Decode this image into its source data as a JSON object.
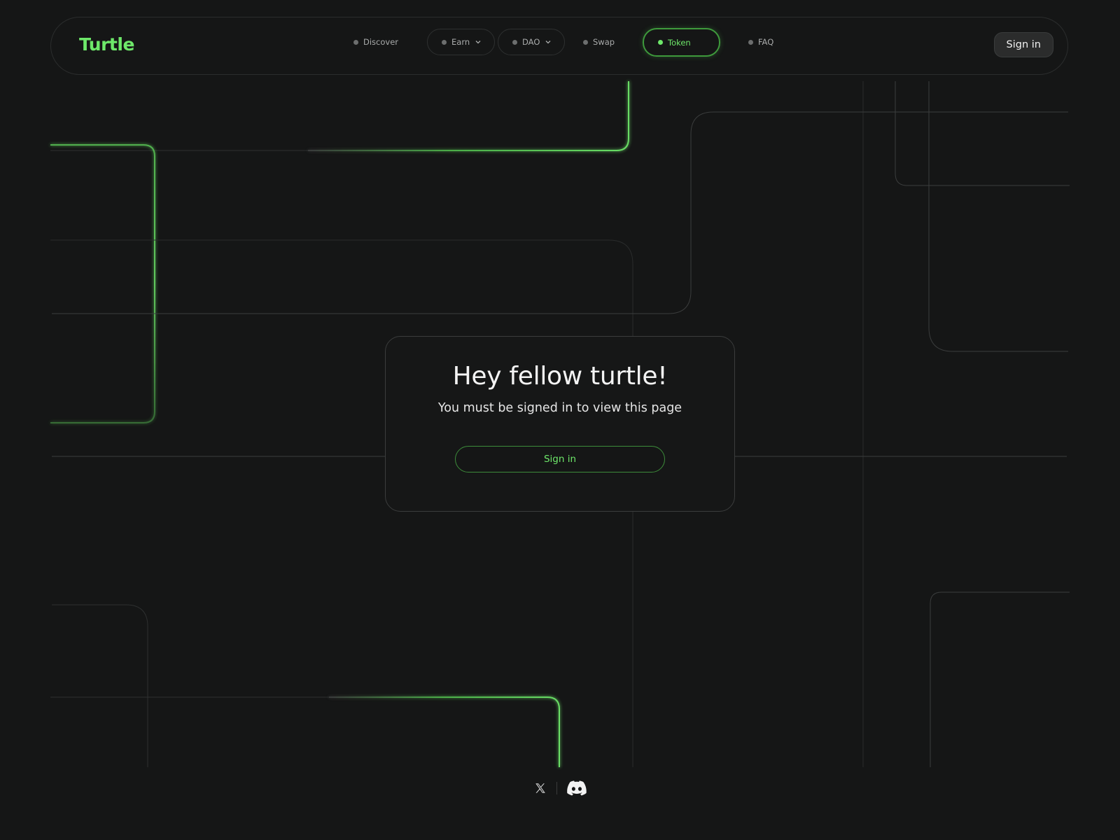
{
  "brand": {
    "name": "Turtle",
    "accent_color": "#6ee86a"
  },
  "nav": {
    "items": [
      {
        "label": "Discover",
        "has_dropdown": false,
        "active": false
      },
      {
        "label": "Earn",
        "has_dropdown": true,
        "active": false
      },
      {
        "label": "DAO",
        "has_dropdown": true,
        "active": false
      },
      {
        "label": "Swap",
        "has_dropdown": false,
        "active": false
      },
      {
        "label": "Token",
        "has_dropdown": false,
        "active": true
      },
      {
        "label": "FAQ",
        "has_dropdown": false,
        "active": false
      }
    ]
  },
  "header": {
    "signin_label": "Sign in"
  },
  "modal": {
    "title": "Hey fellow turtle!",
    "subtitle": "You must be signed in to view this page",
    "button_label": "Sign in"
  },
  "footer": {
    "socials": [
      {
        "icon": "x-icon"
      },
      {
        "icon": "discord-icon"
      }
    ]
  }
}
